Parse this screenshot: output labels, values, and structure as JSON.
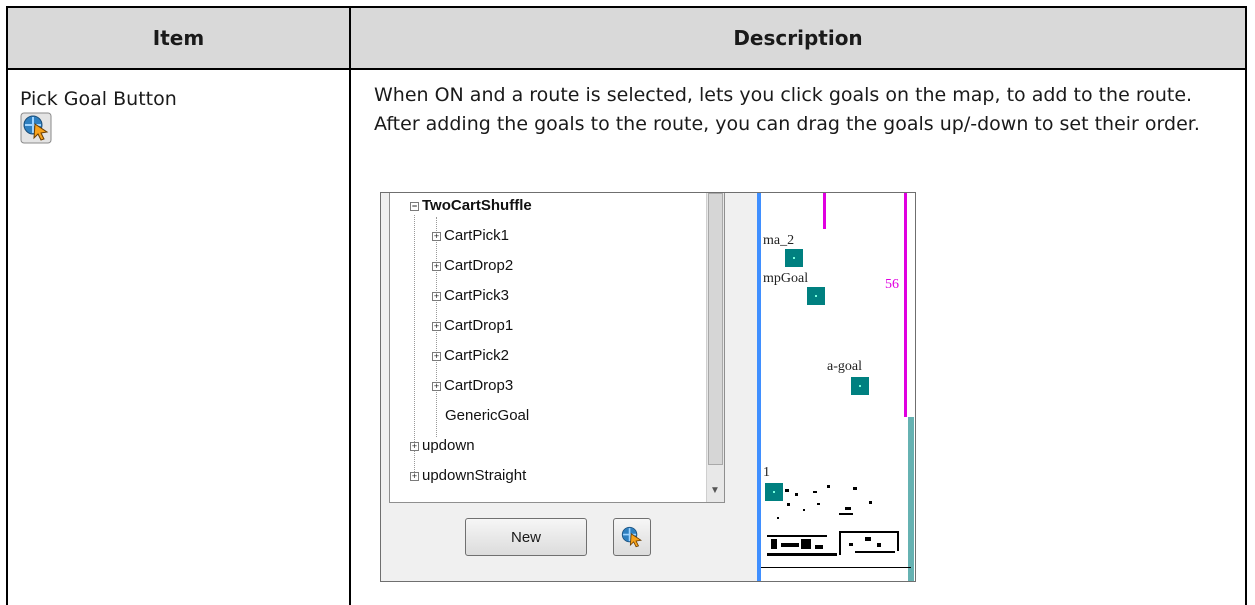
{
  "table": {
    "col_item": "Item",
    "col_description": "Description"
  },
  "row": {
    "item_name": "Pick Goal Button",
    "item_icon": "pick-goal-icon",
    "description": "When ON and a route is selected, lets you click goals on the map, to add to the route. After adding the goals to the route, you can drag the goals up/-down to set their order."
  },
  "screenshot": {
    "tree": {
      "root": "TwoCartShuffle",
      "children": [
        "CartPick1",
        "CartDrop2",
        "CartPick3",
        "CartDrop1",
        "CartPick2",
        "CartDrop3",
        "GenericGoal"
      ],
      "siblings": [
        "updown",
        "updownStraight"
      ]
    },
    "new_button": "New",
    "map_labels": {
      "label_1": "ma_2",
      "label_2": "mpGoal",
      "label_3": "56",
      "label_4": "a-goal",
      "label_5": "1"
    }
  },
  "colors": {
    "header_bg": "#d9d9d9",
    "goal": "#008080",
    "map_line": "#e000e0",
    "map_edge": "#3f8fff"
  }
}
